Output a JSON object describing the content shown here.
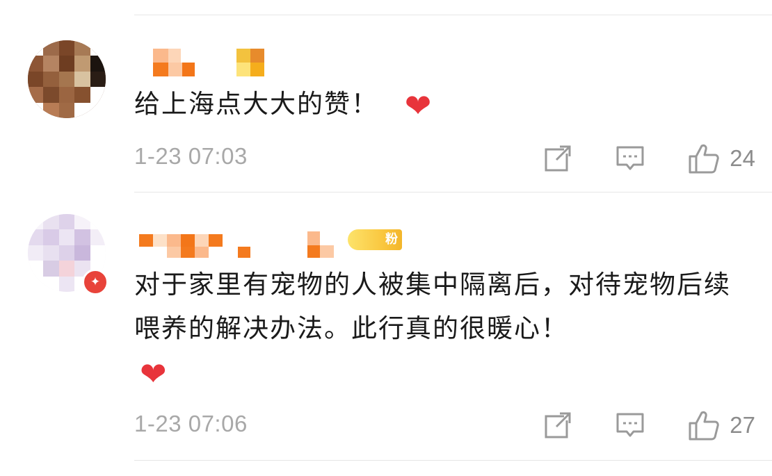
{
  "comments": [
    {
      "text": "给上海点大大的赞！",
      "time": "1-23 07:03",
      "likes": "24",
      "emoji": "heart-emoji"
    },
    {
      "text": "对于家里有宠物的人被集中隔离后，对待宠物后续喂养的解决办法。此行真的很暖心！",
      "time": "1-23 07:06",
      "likes": "27",
      "emoji": "heart-emoji",
      "badge_text": "粉"
    }
  ],
  "colors": {
    "text": "#1a1a1a",
    "meta": "#a8a8a8",
    "heart": "#e8343b",
    "divider": "#e6e6e6",
    "username_blur": "#f47a1e"
  },
  "icons": [
    "share-icon",
    "comment-icon",
    "like-icon",
    "heart-emoji",
    "verified-icon"
  ]
}
